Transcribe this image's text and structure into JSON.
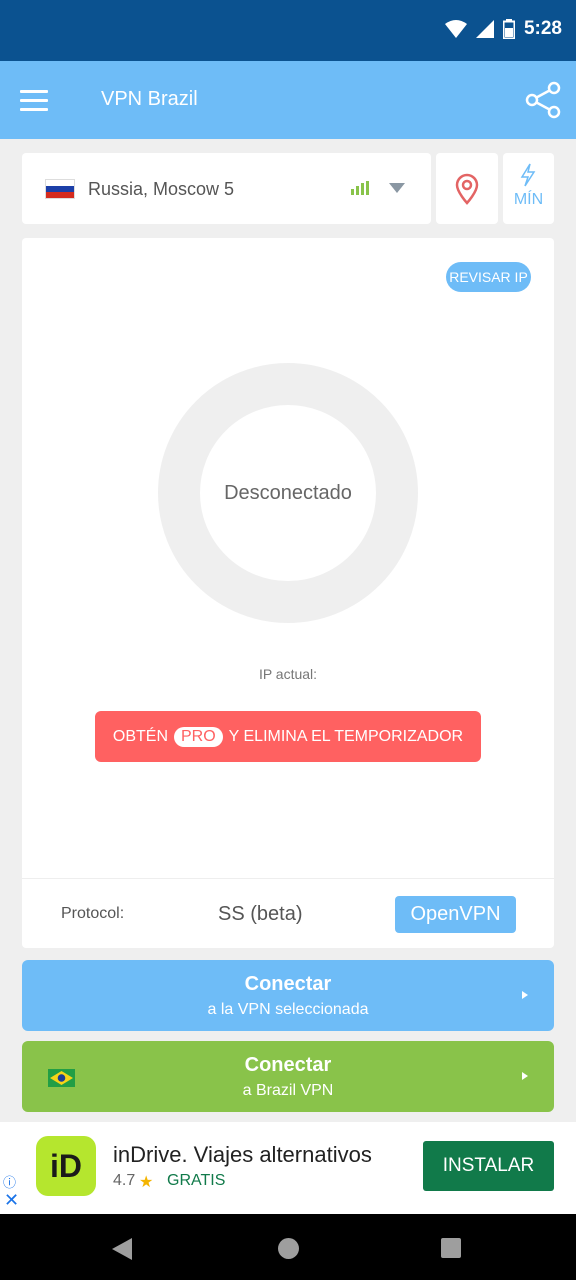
{
  "status_bar": {
    "time": "5:28"
  },
  "app_bar": {
    "title": "VPN Brazil"
  },
  "server": {
    "name": "Russia, Moscow 5"
  },
  "speed_mode": {
    "label": "MÍN"
  },
  "main": {
    "check_ip_label": "REVISAR IP",
    "connection_status": "Desconectado",
    "current_ip_label": "IP actual:",
    "pro_banner": {
      "prefix": "OBTÉN",
      "badge": "PRO",
      "suffix": "Y ELIMINA EL TEMPORIZADOR"
    },
    "protocol": {
      "label": "Protocol:",
      "options": [
        "SS (beta)",
        "OpenVPN"
      ],
      "selected": "OpenVPN"
    }
  },
  "connect_selected": {
    "title": "Conectar",
    "subtitle": "a la VPN seleccionada"
  },
  "connect_brazil": {
    "title": "Conectar",
    "subtitle": "a Brazil VPN"
  },
  "ad": {
    "title": "inDrive. Viajes alternativos",
    "rating": "4.7",
    "price": "GRATIS",
    "cta": "INSTALAR",
    "logo_text": "iD"
  },
  "colors": {
    "primary": "#6ebcf7",
    "status_bar": "#0b5290",
    "green": "#89c34a",
    "red": "#ff6161",
    "ad_green": "#117a4a"
  }
}
